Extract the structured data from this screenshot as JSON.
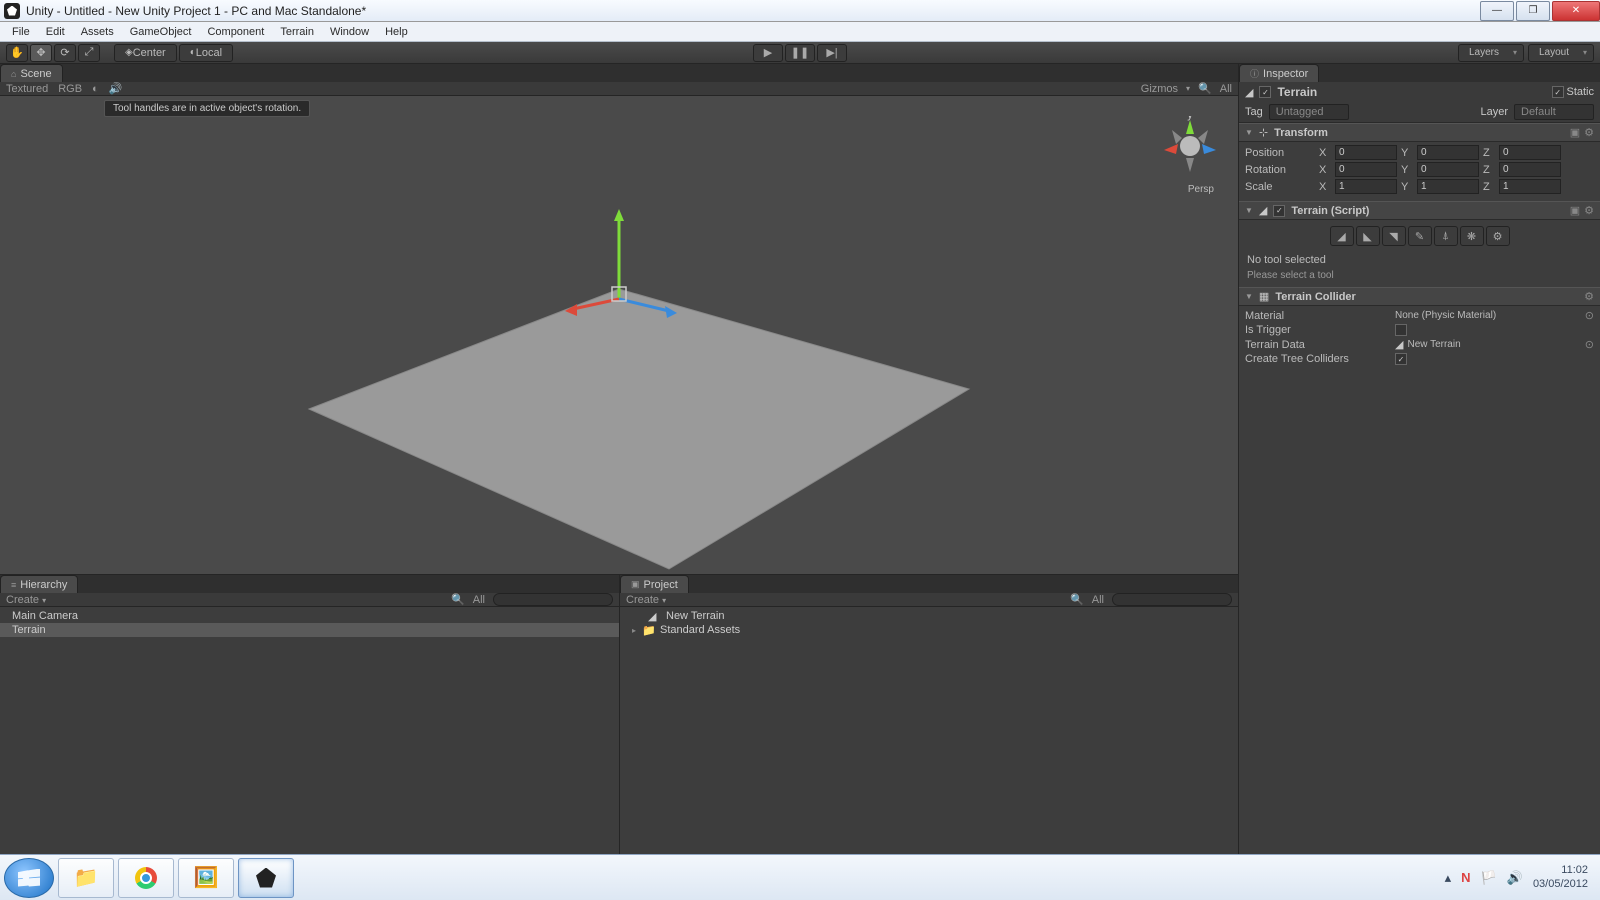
{
  "window": {
    "title": "Unity - Untitled - New Unity Project 1 - PC and Mac Standalone*"
  },
  "menu": [
    "File",
    "Edit",
    "Assets",
    "GameObject",
    "Component",
    "Terrain",
    "Window",
    "Help"
  ],
  "toolbar": {
    "pivot_center": "Center",
    "pivot_local": "Local",
    "layers": "Layers",
    "layout": "Layout"
  },
  "scene": {
    "tab": "Scene",
    "shading": "Textured",
    "render_mode": "RGB",
    "gizmos": "Gizmos",
    "search_label": "All",
    "tooltip": "Tool handles are in active object's rotation.",
    "persp": "Persp",
    "axis_labels": {
      "y": "y"
    }
  },
  "hierarchy": {
    "tab": "Hierarchy",
    "create": "Create",
    "search_label": "All",
    "items": [
      "Main Camera",
      "Terrain"
    ],
    "selected_index": 1
  },
  "project": {
    "tab": "Project",
    "create": "Create",
    "search_label": "All",
    "items": [
      {
        "name": "New Terrain",
        "folder": false
      },
      {
        "name": "Standard Assets",
        "folder": true
      }
    ]
  },
  "inspector": {
    "tab": "Inspector",
    "object_name": "Terrain",
    "static_label": "Static",
    "tag_label": "Tag",
    "tag_value": "Untagged",
    "layer_label": "Layer",
    "layer_value": "Default",
    "transform": {
      "title": "Transform",
      "position_label": "Position",
      "rotation_label": "Rotation",
      "scale_label": "Scale",
      "position": {
        "x": "0",
        "y": "0",
        "z": "0"
      },
      "rotation": {
        "x": "0",
        "y": "0",
        "z": "0"
      },
      "scale": {
        "x": "1",
        "y": "1",
        "z": "1"
      }
    },
    "terrain_script": {
      "title": "Terrain (Script)",
      "status1": "No tool selected",
      "status2": "Please select a tool"
    },
    "terrain_collider": {
      "title": "Terrain Collider",
      "material_label": "Material",
      "material_value": "None (Physic Material)",
      "is_trigger_label": "Is Trigger",
      "terrain_data_label": "Terrain Data",
      "terrain_data_value": "New Terrain",
      "create_trees_label": "Create Tree Colliders"
    }
  },
  "taskbar": {
    "time": "11:02",
    "date": "03/05/2012"
  }
}
